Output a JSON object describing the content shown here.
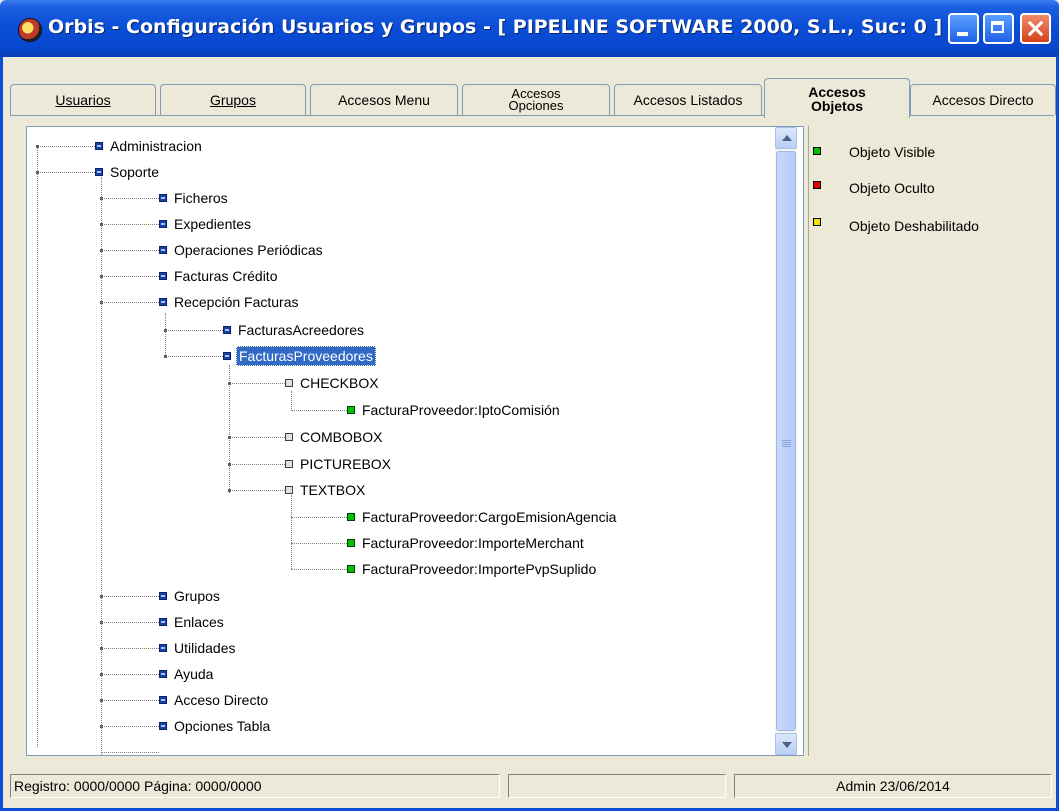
{
  "window": {
    "title": "Orbis - Configuración Usuarios y Grupos - [ PIPELINE SOFTWARE 2000, S.L.,  Suc: 0 ]"
  },
  "tabs": [
    {
      "label": "Usuarios"
    },
    {
      "label": "Grupos"
    },
    {
      "label": "Accesos Menu"
    },
    {
      "label_line1": "Accesos",
      "label_line2": "Opciones"
    },
    {
      "label": "Accesos Listados"
    },
    {
      "label_line1": "Accesos",
      "label_line2": "Objetos",
      "active": true
    },
    {
      "label": "Accesos Directo"
    }
  ],
  "tree": {
    "nodes": [
      {
        "label": "Administracion",
        "icon": "blue-square-icon"
      },
      {
        "label": "Soporte",
        "icon": "blue-square-icon"
      },
      {
        "label": "Ficheros",
        "icon": "blue-square-icon"
      },
      {
        "label": "Expedientes",
        "icon": "blue-square-icon"
      },
      {
        "label": "Operaciones Periódicas",
        "icon": "blue-square-icon"
      },
      {
        "label": "Facturas Crédito",
        "icon": "blue-square-icon"
      },
      {
        "label": "Recepción Facturas",
        "icon": "blue-square-icon"
      },
      {
        "label": "FacturasAcreedores",
        "icon": "blue-square-icon"
      },
      {
        "label": "FacturasProveedores",
        "icon": "blue-square-icon",
        "selected": true
      },
      {
        "label": "CHECKBOX",
        "icon": "gray-square-icon"
      },
      {
        "label": "FacturaProveedor:IptoComisión",
        "icon": "green-square-icon"
      },
      {
        "label": "COMBOBOX",
        "icon": "gray-square-icon"
      },
      {
        "label": "PICTUREBOX",
        "icon": "gray-square-icon"
      },
      {
        "label": "TEXTBOX",
        "icon": "gray-square-icon"
      },
      {
        "label": "FacturaProveedor:CargoEmisionAgencia",
        "icon": "green-square-icon"
      },
      {
        "label": "FacturaProveedor:ImporteMerchant",
        "icon": "green-square-icon"
      },
      {
        "label": "FacturaProveedor:ImportePvpSuplido",
        "icon": "green-square-icon"
      },
      {
        "label": "Grupos",
        "icon": "blue-square-icon"
      },
      {
        "label": "Enlaces",
        "icon": "blue-square-icon"
      },
      {
        "label": "Utilidades",
        "icon": "blue-square-icon"
      },
      {
        "label": "Ayuda",
        "icon": "blue-square-icon"
      },
      {
        "label": "Acceso Directo",
        "icon": "blue-square-icon"
      },
      {
        "label": "Opciones Tabla",
        "icon": "blue-square-icon"
      }
    ]
  },
  "legend": [
    {
      "label": "Objeto Visible",
      "color": "#00c000"
    },
    {
      "label": "Objeto Oculto",
      "color": "#e00000"
    },
    {
      "label": "Objeto Deshabilitado",
      "color": "#f0e000"
    }
  ],
  "status": {
    "registro": "Registro: 0000/0000  Página: 0000/0000",
    "user_date": "Admin 23/06/2014"
  }
}
